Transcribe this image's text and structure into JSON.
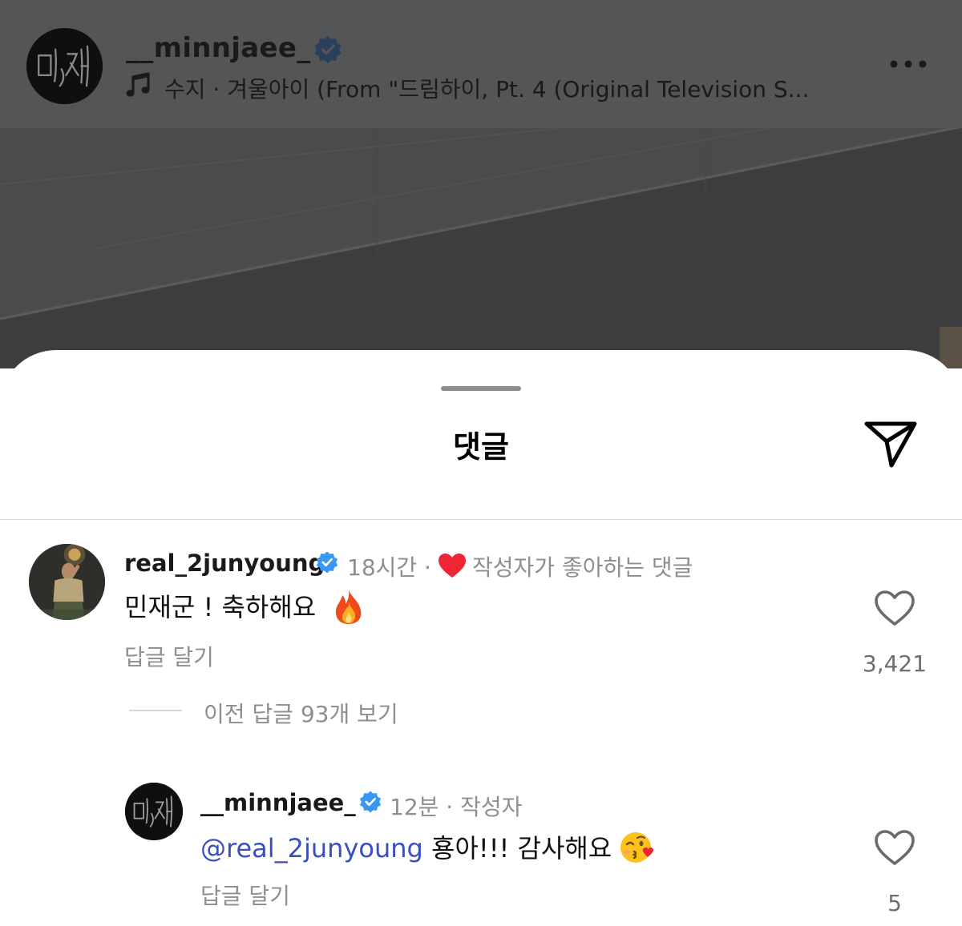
{
  "post_header": {
    "username": "__minnjaee_",
    "music_text": "수지 · 겨울아이 (From \"드림하이, Pt. 4 (Original Television S...",
    "avatar_signature": "민재",
    "icons": [
      "verified-badge-icon",
      "music-note-icon",
      "more-options-icon"
    ]
  },
  "sheet": {
    "title": "댓글",
    "share_icon": "paper-plane-icon"
  },
  "comments": [
    {
      "username": "real_2junyoung",
      "time": "18시간",
      "liked_by_author_label": "작성자가 좋아하는 댓글",
      "text": "민재군 ! 축하해요",
      "emoji": "fire",
      "reply_label": "답글 달기",
      "likes": "3,421"
    }
  ],
  "view_replies_label": "이전 답글 93개 보기",
  "replies": [
    {
      "username": "__minnjaee_",
      "time": "12분",
      "author_label": "작성자",
      "mention": "@real_2junyoung",
      "text": "횽아!!! 감사해요",
      "emoji": "face-blowing-kiss",
      "reply_label": "답글 달기",
      "likes": "5"
    }
  ],
  "colors": {
    "verified_blue": "#3897f0",
    "mention_blue": "#3b4ec0",
    "liked_heart_red": "#ed2535",
    "dim_overlay": "#545557"
  }
}
